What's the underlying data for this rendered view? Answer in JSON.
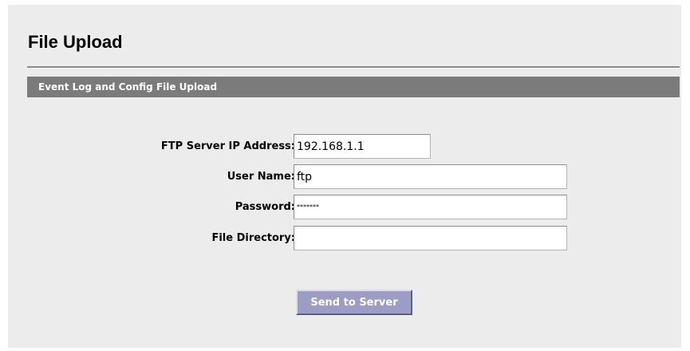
{
  "page": {
    "title": "File Upload"
  },
  "section": {
    "title": "Event Log and Config File Upload"
  },
  "form": {
    "ftp_ip": {
      "label": "FTP Server IP Address:",
      "value": "192.168.1.1"
    },
    "username": {
      "label": "User Name:",
      "value": "ftp"
    },
    "password": {
      "label": "Password:",
      "value": "*******"
    },
    "directory": {
      "label": "File Directory:",
      "value": ""
    }
  },
  "actions": {
    "send_label": "Send to Server"
  },
  "colors": {
    "panel_bg": "#ececec",
    "section_bar": "#7b7b7b",
    "button_bg": "#9c9cc4"
  }
}
